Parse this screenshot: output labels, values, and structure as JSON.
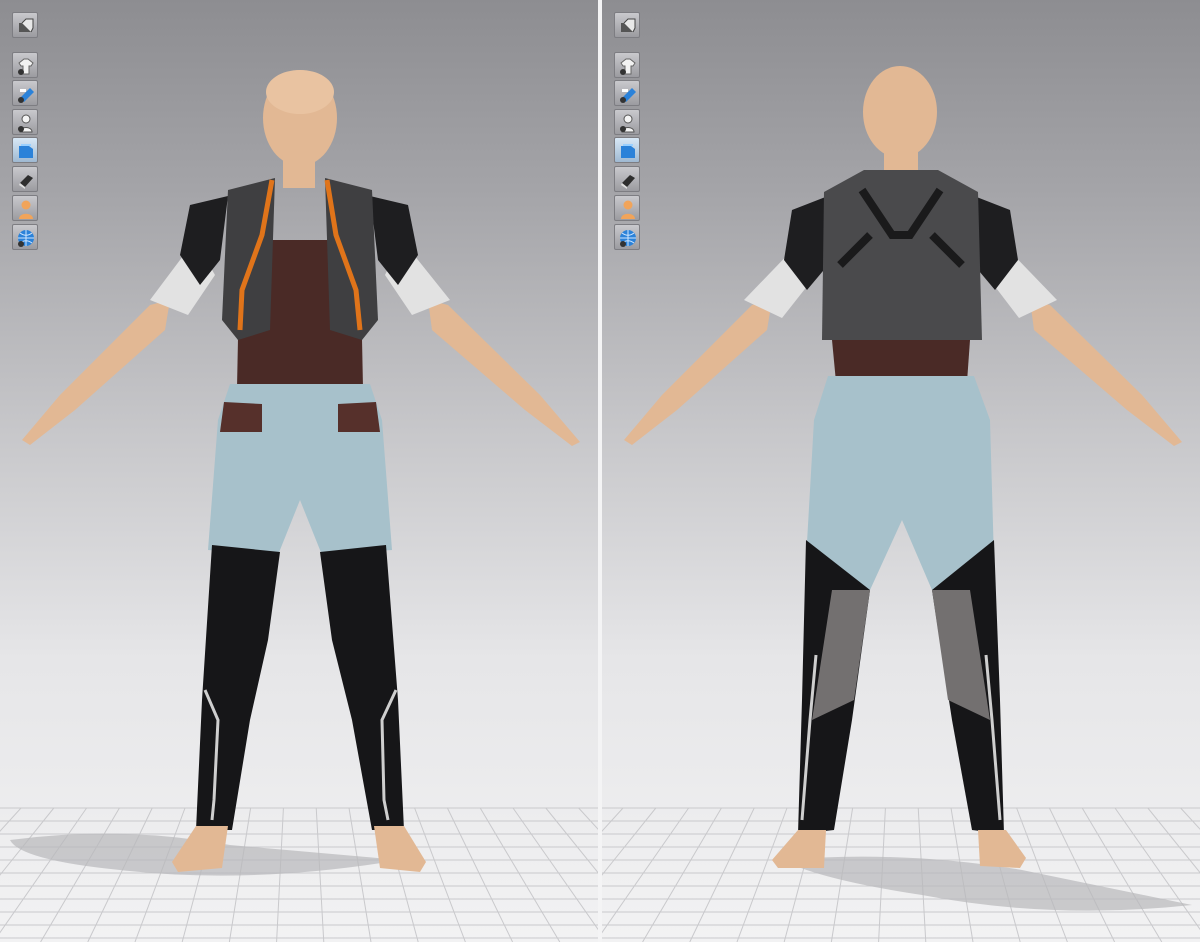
{
  "viewports": [
    {
      "view": "front",
      "toolbar": [
        {
          "icon": "camera-view-icon"
        },
        {
          "icon": "show-garment-icon"
        },
        {
          "icon": "show-fabric-icon"
        },
        {
          "icon": "show-avatar-icon"
        },
        {
          "icon": "texture-surface-icon",
          "active": true
        },
        {
          "icon": "render-mode-icon"
        },
        {
          "icon": "avatar-skin-icon"
        },
        {
          "icon": "environment-globe-icon"
        }
      ]
    },
    {
      "view": "back",
      "toolbar": [
        {
          "icon": "camera-view-icon"
        },
        {
          "icon": "show-garment-icon"
        },
        {
          "icon": "show-fabric-icon"
        },
        {
          "icon": "show-avatar-icon"
        },
        {
          "icon": "texture-surface-icon",
          "active": true
        },
        {
          "icon": "render-mode-icon"
        },
        {
          "icon": "avatar-skin-icon"
        },
        {
          "icon": "environment-globe-icon"
        }
      ]
    }
  ],
  "colors": {
    "skin": "#e2b894",
    "jacket": "#3f3f41",
    "jacket_trim": "#e0741a",
    "sleeve": "#e2e2e2",
    "top": "#4a2a26",
    "pants": "#a7c1cb",
    "leggings": "#161618",
    "mesh_panel": "#737070",
    "floor_grid": "#c9c9cc",
    "accent_blue": "#2b82d9"
  }
}
